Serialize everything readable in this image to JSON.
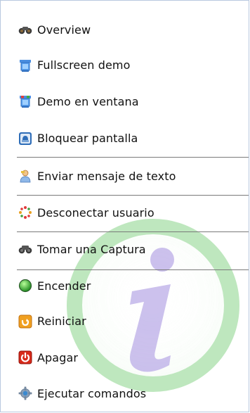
{
  "menu": {
    "items": [
      {
        "label": "Overview",
        "icon": "binoculars-icon"
      },
      {
        "label": "Fullscreen demo",
        "icon": "monitor-blue-icon"
      },
      {
        "label": "Demo en ventana",
        "icon": "monitor-color-icon"
      },
      {
        "label": "Bloquear pantalla",
        "icon": "lock-screen-icon"
      },
      {
        "label": "Enviar mensaje de texto",
        "icon": "user-message-icon"
      },
      {
        "label": "Desconectar usuario",
        "icon": "disconnect-icon"
      },
      {
        "label": "Tomar una Captura",
        "icon": "camera-binoculars-icon"
      },
      {
        "label": "Encender",
        "icon": "power-on-green-icon"
      },
      {
        "label": "Reiniciar",
        "icon": "restart-orange-icon"
      },
      {
        "label": "Apagar",
        "icon": "power-off-red-icon"
      },
      {
        "label": "Ejecutar comandos",
        "icon": "gear-icon"
      }
    ]
  },
  "colors": {
    "panel_border": "#b9c9df",
    "separator": "#7a7a7a",
    "watermark_ring": "#8fd48f",
    "watermark_fill": "#b8a9e6"
  }
}
